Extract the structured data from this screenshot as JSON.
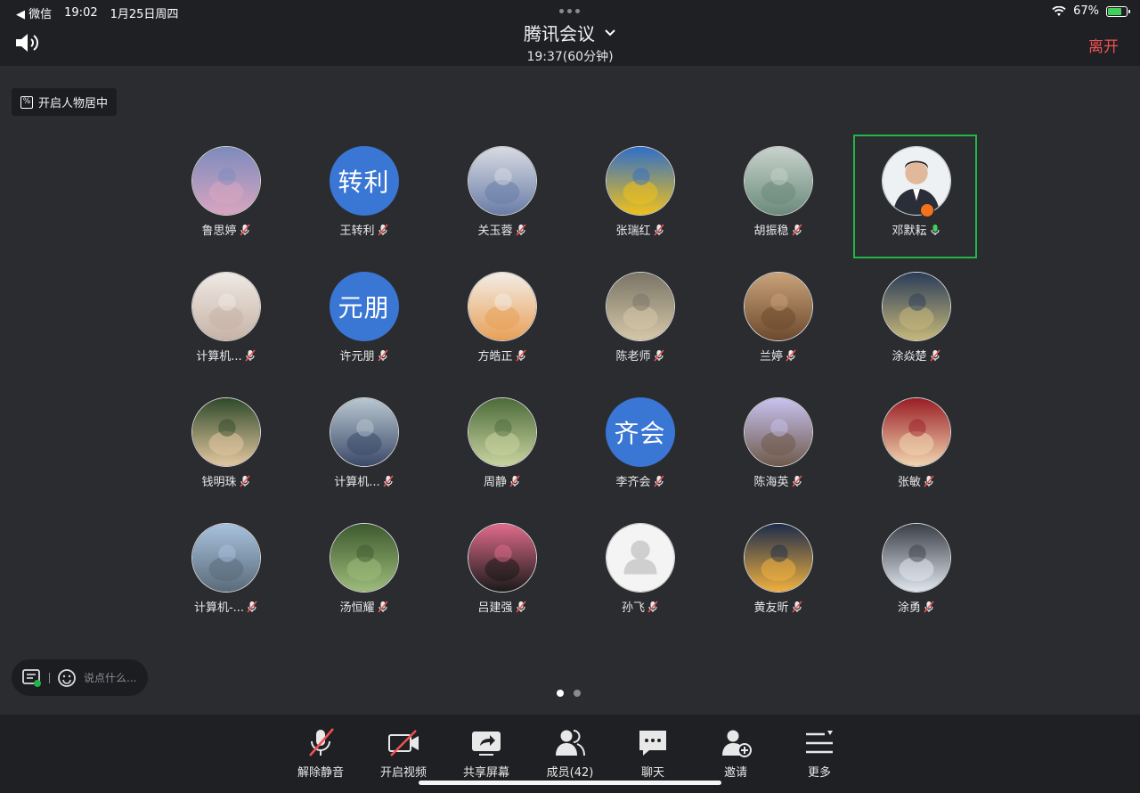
{
  "status": {
    "back_app": "◀ 微信",
    "time": "19:02",
    "date": "1月25日周四",
    "battery": "67%"
  },
  "header": {
    "title": "腾讯会议",
    "subtitle": "19:37(60分钟)",
    "leave": "离开"
  },
  "center_toggle": {
    "label": "开启人物居中"
  },
  "participants": [
    {
      "name": "鲁思婷"
    },
    {
      "name": "王转利",
      "avatar_text": "转利"
    },
    {
      "name": "关玉蓉"
    },
    {
      "name": "张瑞红"
    },
    {
      "name": "胡振稳"
    },
    {
      "name": "邓默耘"
    },
    {
      "name": "计算机..."
    },
    {
      "name": "许元朋",
      "avatar_text": "元朋"
    },
    {
      "name": "方皓正"
    },
    {
      "name": "陈老师"
    },
    {
      "name": "兰婷"
    },
    {
      "name": "涂焱楚"
    },
    {
      "name": "钱明珠"
    },
    {
      "name": "计算机..."
    },
    {
      "name": "周静"
    },
    {
      "name": "李齐会",
      "avatar_text": "齐会"
    },
    {
      "name": "陈海英"
    },
    {
      "name": "张敏"
    },
    {
      "name": "计算机-..."
    },
    {
      "name": "汤恒耀"
    },
    {
      "name": "吕建强"
    },
    {
      "name": "孙飞"
    },
    {
      "name": "黄友昕"
    },
    {
      "name": "涂勇"
    }
  ],
  "chat": {
    "placeholder": "说点什么..."
  },
  "toolbar": {
    "unmute": "解除静音",
    "video": "开启视频",
    "share": "共享屏幕",
    "members": "成员(42)",
    "chat": "聊天",
    "invite": "邀请",
    "more": "更多"
  },
  "colors": {
    "accent_red": "#f05252",
    "active_border": "#23b548",
    "text_avatar": "#3a76d4",
    "host_badge": "#f2731c"
  }
}
